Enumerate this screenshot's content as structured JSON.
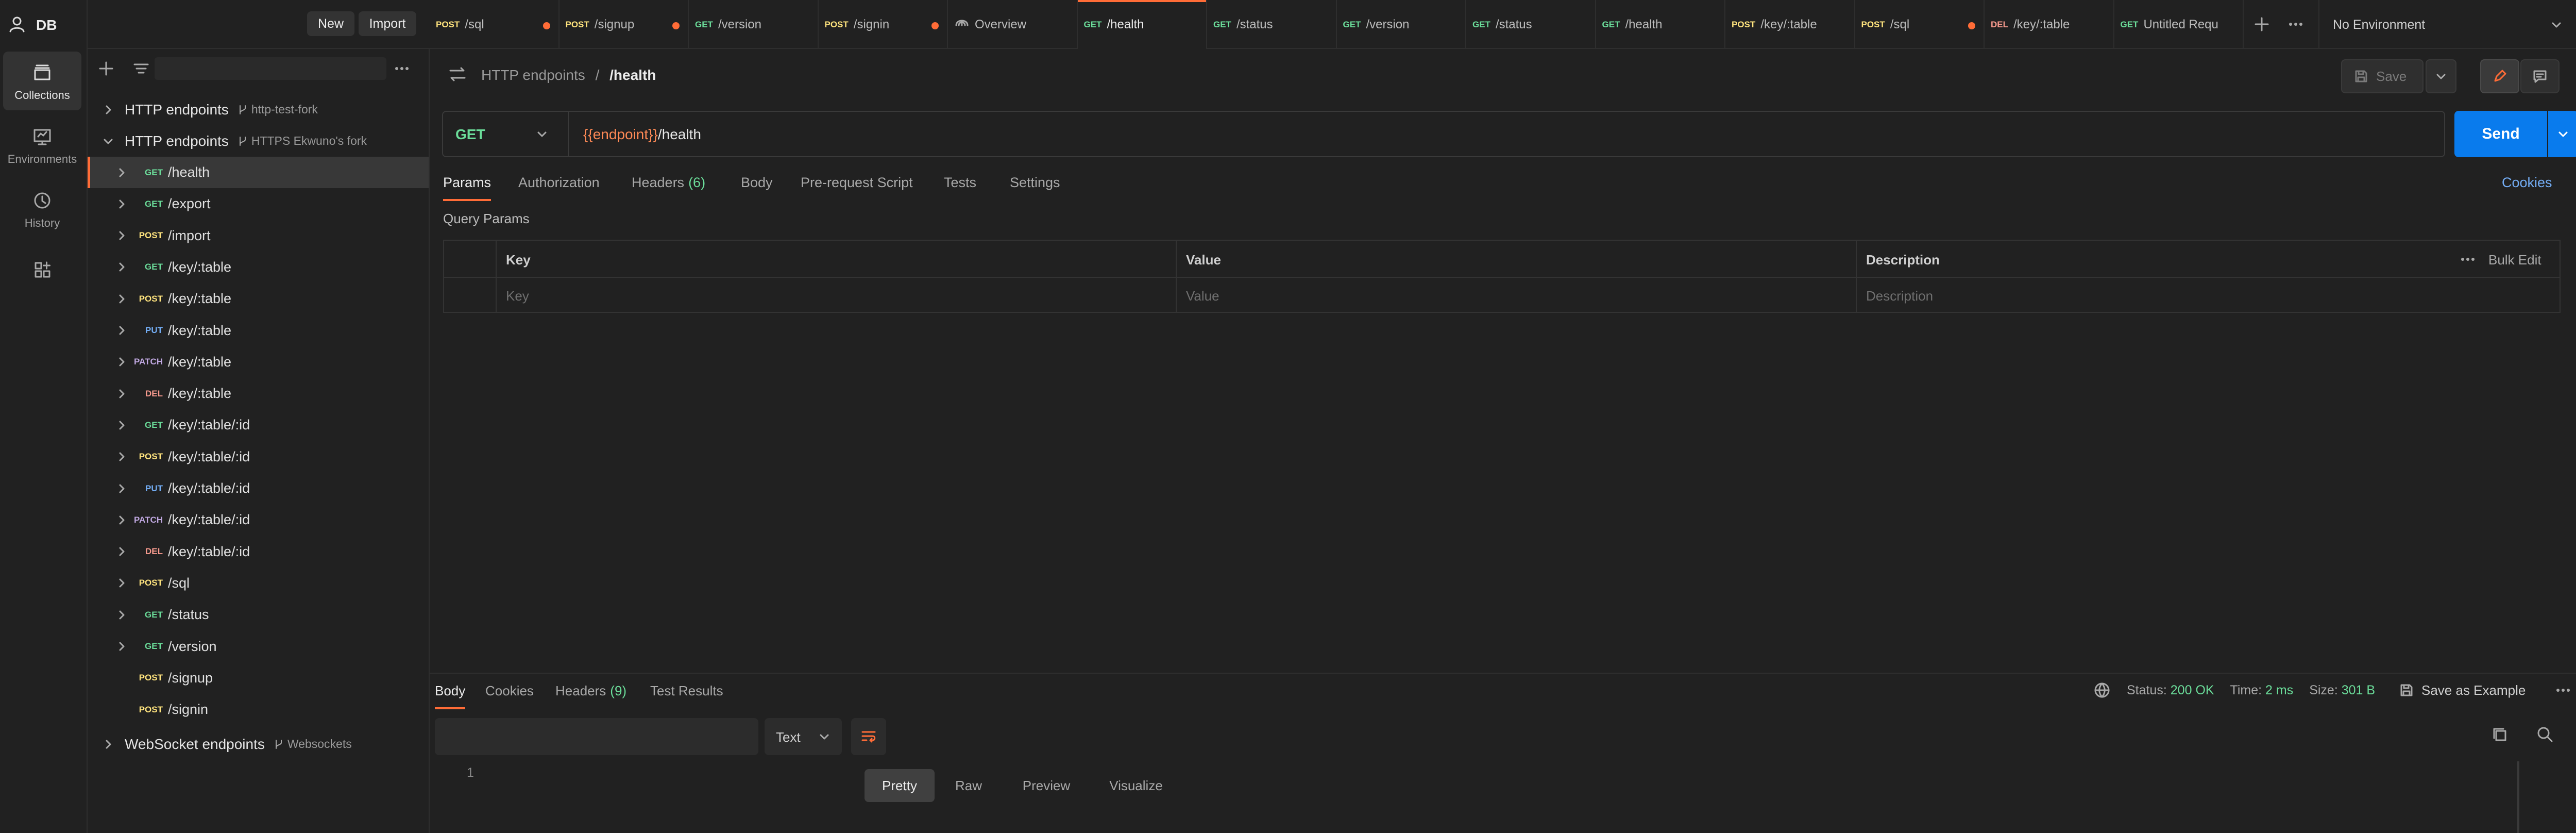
{
  "workspace": {
    "name": "DB",
    "new_label": "New",
    "import_label": "Import"
  },
  "rail": {
    "items": [
      {
        "label": "Collections",
        "icon": "collections-icon"
      },
      {
        "label": "Environments",
        "icon": "environments-icon"
      },
      {
        "label": "History",
        "icon": "history-icon"
      },
      {
        "label": "",
        "icon": "configure-sidebar-icon"
      }
    ]
  },
  "collections": [
    {
      "name": "HTTP endpoints",
      "fork": "http-test-fork",
      "expanded": false
    },
    {
      "name": "HTTP endpoints",
      "fork": "HTTPS Ekwuno's fork",
      "expanded": true
    },
    {
      "name": "WebSocket endpoints",
      "fork": "Websockets",
      "expanded": false
    }
  ],
  "requests": [
    {
      "method": "GET",
      "path": "/health",
      "selected": true,
      "chevron": true
    },
    {
      "method": "GET",
      "path": "/export",
      "chevron": true
    },
    {
      "method": "POST",
      "path": "/import",
      "chevron": true
    },
    {
      "method": "GET",
      "path": "/key/:table",
      "chevron": true
    },
    {
      "method": "POST",
      "path": "/key/:table",
      "chevron": true
    },
    {
      "method": "PUT",
      "path": "/key/:table",
      "chevron": true
    },
    {
      "method": "PATCH",
      "path": "/key/:table",
      "chevron": true
    },
    {
      "method": "DEL",
      "path": "/key/:table",
      "chevron": true
    },
    {
      "method": "GET",
      "path": "/key/:table/:id",
      "chevron": true
    },
    {
      "method": "POST",
      "path": "/key/:table/:id",
      "chevron": true
    },
    {
      "method": "PUT",
      "path": "/key/:table/:id",
      "chevron": true
    },
    {
      "method": "PATCH",
      "path": "/key/:table/:id",
      "chevron": true
    },
    {
      "method": "DEL",
      "path": "/key/:table/:id",
      "chevron": true
    },
    {
      "method": "POST",
      "path": "/sql",
      "chevron": true
    },
    {
      "method": "GET",
      "path": "/status",
      "chevron": true
    },
    {
      "method": "GET",
      "path": "/version",
      "chevron": true
    },
    {
      "method": "POST",
      "path": "/signup",
      "chevron": false
    },
    {
      "method": "POST",
      "path": "/signin",
      "chevron": false
    }
  ],
  "tabs": [
    {
      "method": "POST",
      "label": "/sql",
      "dot": true
    },
    {
      "method": "POST",
      "label": "/signup",
      "dot": true
    },
    {
      "method": "GET",
      "label": "/version",
      "dot": false
    },
    {
      "method": "POST",
      "label": "/signin",
      "dot": true
    },
    {
      "method": "",
      "label": "Overview",
      "dot": false,
      "overview": true
    },
    {
      "method": "GET",
      "label": "/health",
      "dot": false,
      "active": true
    },
    {
      "method": "GET",
      "label": "/status",
      "dot": false
    },
    {
      "method": "GET",
      "label": "/version",
      "dot": false
    },
    {
      "method": "GET",
      "label": "/status",
      "dot": false
    },
    {
      "method": "GET",
      "label": "/health",
      "dot": false
    },
    {
      "method": "POST",
      "label": "/key/:table",
      "dot": false
    },
    {
      "method": "POST",
      "label": "/sql",
      "dot": true
    },
    {
      "method": "DEL",
      "label": "/key/:table",
      "dot": false
    },
    {
      "method": "GET",
      "label": "Untitled Requ",
      "dot": false
    }
  ],
  "environment": {
    "selected": "No Environment"
  },
  "request": {
    "breadcrumb_parent": "HTTP endpoints",
    "breadcrumb_sep": "/",
    "breadcrumb_current": "/health",
    "save_label": "Save",
    "method": "GET",
    "url_var": "{{endpoint}}",
    "url_path": "/health",
    "send_label": "Send",
    "tabs": [
      {
        "label": "Params",
        "active": true
      },
      {
        "label": "Authorization"
      },
      {
        "label": "Headers",
        "count": "(6)"
      },
      {
        "label": "Body"
      },
      {
        "label": "Pre-request Script"
      },
      {
        "label": "Tests"
      },
      {
        "label": "Settings"
      }
    ],
    "cookies_label": "Cookies",
    "query_params_title": "Query Params",
    "table": {
      "headers": [
        "Key",
        "Value",
        "Description"
      ],
      "placeholders": [
        "Key",
        "Value",
        "Description"
      ],
      "bulk_edit_label": "Bulk Edit"
    }
  },
  "response": {
    "tabs": [
      {
        "label": "Body",
        "active": true
      },
      {
        "label": "Cookies"
      },
      {
        "label": "Headers",
        "count": "(9)"
      },
      {
        "label": "Test Results"
      }
    ],
    "status_label": "Status:",
    "status_value": "200 OK",
    "time_label": "Time:",
    "time_value": "2 ms",
    "size_label": "Size:",
    "size_value": "301 B",
    "save_example_label": "Save as Example",
    "views": [
      "Pretty",
      "Raw",
      "Preview",
      "Visualize"
    ],
    "active_view": "Pretty",
    "format": "Text",
    "line_number": "1"
  },
  "colors": {
    "accent": "#ff6c37",
    "send": "#097bed",
    "status_ok": "#6bdd9a",
    "get": "#6bdd9a",
    "post": "#ffe47e",
    "put": "#74aef6",
    "patch": "#c0a8e1",
    "del": "#f79a8e",
    "link": "#74aef6"
  }
}
